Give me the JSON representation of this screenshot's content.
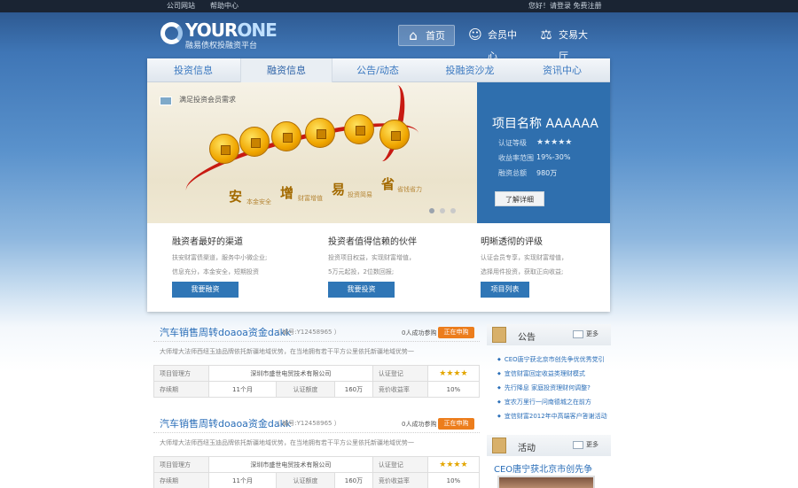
{
  "topbar": {
    "links": [
      "公司网站",
      "帮助中心"
    ],
    "right": "您好！请登录  免费注册"
  },
  "logo": {
    "brand_a": "YOUR",
    "brand_b": "ONE",
    "slogan": "融易债权投融资平台"
  },
  "main_nav": [
    {
      "label": "首页",
      "icon": "home-icon",
      "active": true
    },
    {
      "label": "会员中心",
      "icon": "members-icon",
      "active": false
    },
    {
      "label": "交易大厅",
      "icon": "scales-icon",
      "active": false
    }
  ],
  "tabs": [
    "投资信息",
    "融资信息",
    "公告/动态",
    "投融资沙龙",
    "资讯中心"
  ],
  "active_tab": "融资信息",
  "banner": {
    "caption": "满足投资会员需求",
    "big_words": [
      "安",
      "增",
      "易",
      "省"
    ],
    "small_words": [
      "本金安全",
      "财富增值",
      "投资简易",
      "省钱省力"
    ]
  },
  "project": {
    "name": "项目名称  AAAAAA",
    "rating_label": "认证等级",
    "rating": 5,
    "yield_label": "收益率范围",
    "yield": "19%-30%",
    "total_label": "融资总额",
    "total": "980万",
    "button": "了解详细"
  },
  "features": [
    {
      "title": "融资者最好的渠道",
      "lines": [
        "扶安财富债渠道，服务中小微企业;",
        "信息充分，本金安全，短期投资"
      ],
      "button": "我要融资"
    },
    {
      "title": "投资者值得信赖的伙伴",
      "lines": [
        "投资项目权益，实现财富增值，",
        "5万元起投，2位数回报;"
      ],
      "button": "我要投资"
    },
    {
      "title": "明晰透彻的评级",
      "lines": [
        "认证会员专享，实现财富增值，",
        "选择用件投资，获取正向收益;"
      ],
      "button": "项目列表"
    }
  ],
  "projects": [
    {
      "title": "汽车销售周转doaoa资金dakk",
      "number": "（ 编号:Y12458965 ）",
      "count": "0人成功参购",
      "button": "正在申购",
      "desc": "大师增大法师西纽玉迪品牌依托新疆地域优势，在当地拥有若干平方公里依托新疆地域优势一",
      "manager_label": "项目管理方",
      "manager": "深圳市盛世电贸技术有限公司",
      "cert_label": "认证登记",
      "stars": "★★★★",
      "term_label": "存续期",
      "term": "11个月",
      "amount_label": "认证额度",
      "amount": "160万",
      "yield_label": "竞价收益率",
      "yield": "10%"
    },
    {
      "title": "汽车销售周转doaoa资金dakk",
      "number": "（ 编号:Y12458965 ）",
      "count": "0人成功参购",
      "button": "正在申购",
      "desc": "大师增大法师西纽玉迪品牌依托新疆地域优势，在当地拥有若干平方公里依托新疆地域优势一",
      "manager_label": "项目管理方",
      "manager": "深圳市盛世电贸技术有限公司",
      "cert_label": "认证登记",
      "stars": "★★★★",
      "term_label": "存续期",
      "term": "11个月",
      "amount_label": "认证额度",
      "amount": "160万",
      "yield_label": "竞价收益率",
      "yield": "10%"
    }
  ],
  "announcements": {
    "title": "公告",
    "more": "更多",
    "items": [
      "CEO唐宁获北京市创先争优优秀党引",
      "宜信财富回定收益类理财模式",
      "先行降息 家庭投资理财何调整?",
      "宜农万里行一问南德城之在前方",
      "宜信财富2012年中高端客户答谢活动"
    ]
  },
  "activities": {
    "title": "活动",
    "more": "更多",
    "headline": "CEO唐宁获北京市创先争"
  }
}
